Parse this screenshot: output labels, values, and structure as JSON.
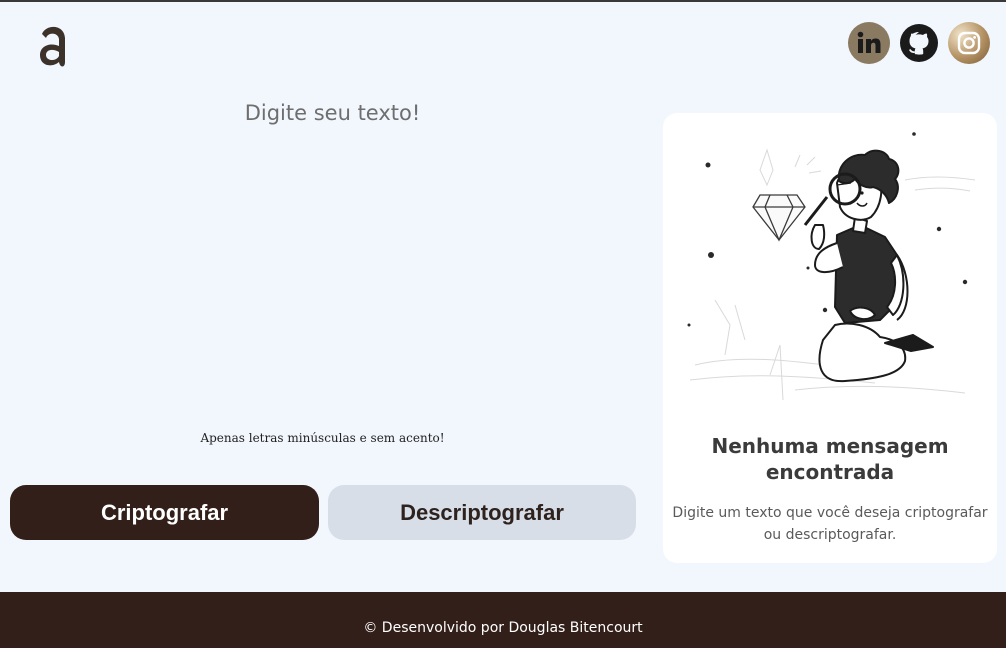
{
  "header": {
    "logo_icon": "letter-a-logo",
    "socials": [
      {
        "name": "linkedin",
        "icon": "linkedin-icon"
      },
      {
        "name": "github",
        "icon": "github-icon"
      },
      {
        "name": "instagram",
        "icon": "instagram-icon"
      }
    ]
  },
  "editor": {
    "placeholder": "Digite seu texto!",
    "value": "",
    "hint": "Apenas letras minúsculas e sem acento!"
  },
  "actions": {
    "encrypt_label": "Criptografar",
    "decrypt_label": "Descriptografar"
  },
  "output": {
    "illustration_icon": "person-magnifying-glass-illustration",
    "title": "Nenhuma mensagem encontrada",
    "description": "Digite um texto que você deseja criptografar ou descriptografar."
  },
  "footer": {
    "text": "© Desenvolvido por Douglas Bitencourt"
  },
  "colors": {
    "background": "#f2f7fe",
    "primary": "#331f19",
    "secondary": "#d8dee8",
    "card": "#ffffff"
  }
}
